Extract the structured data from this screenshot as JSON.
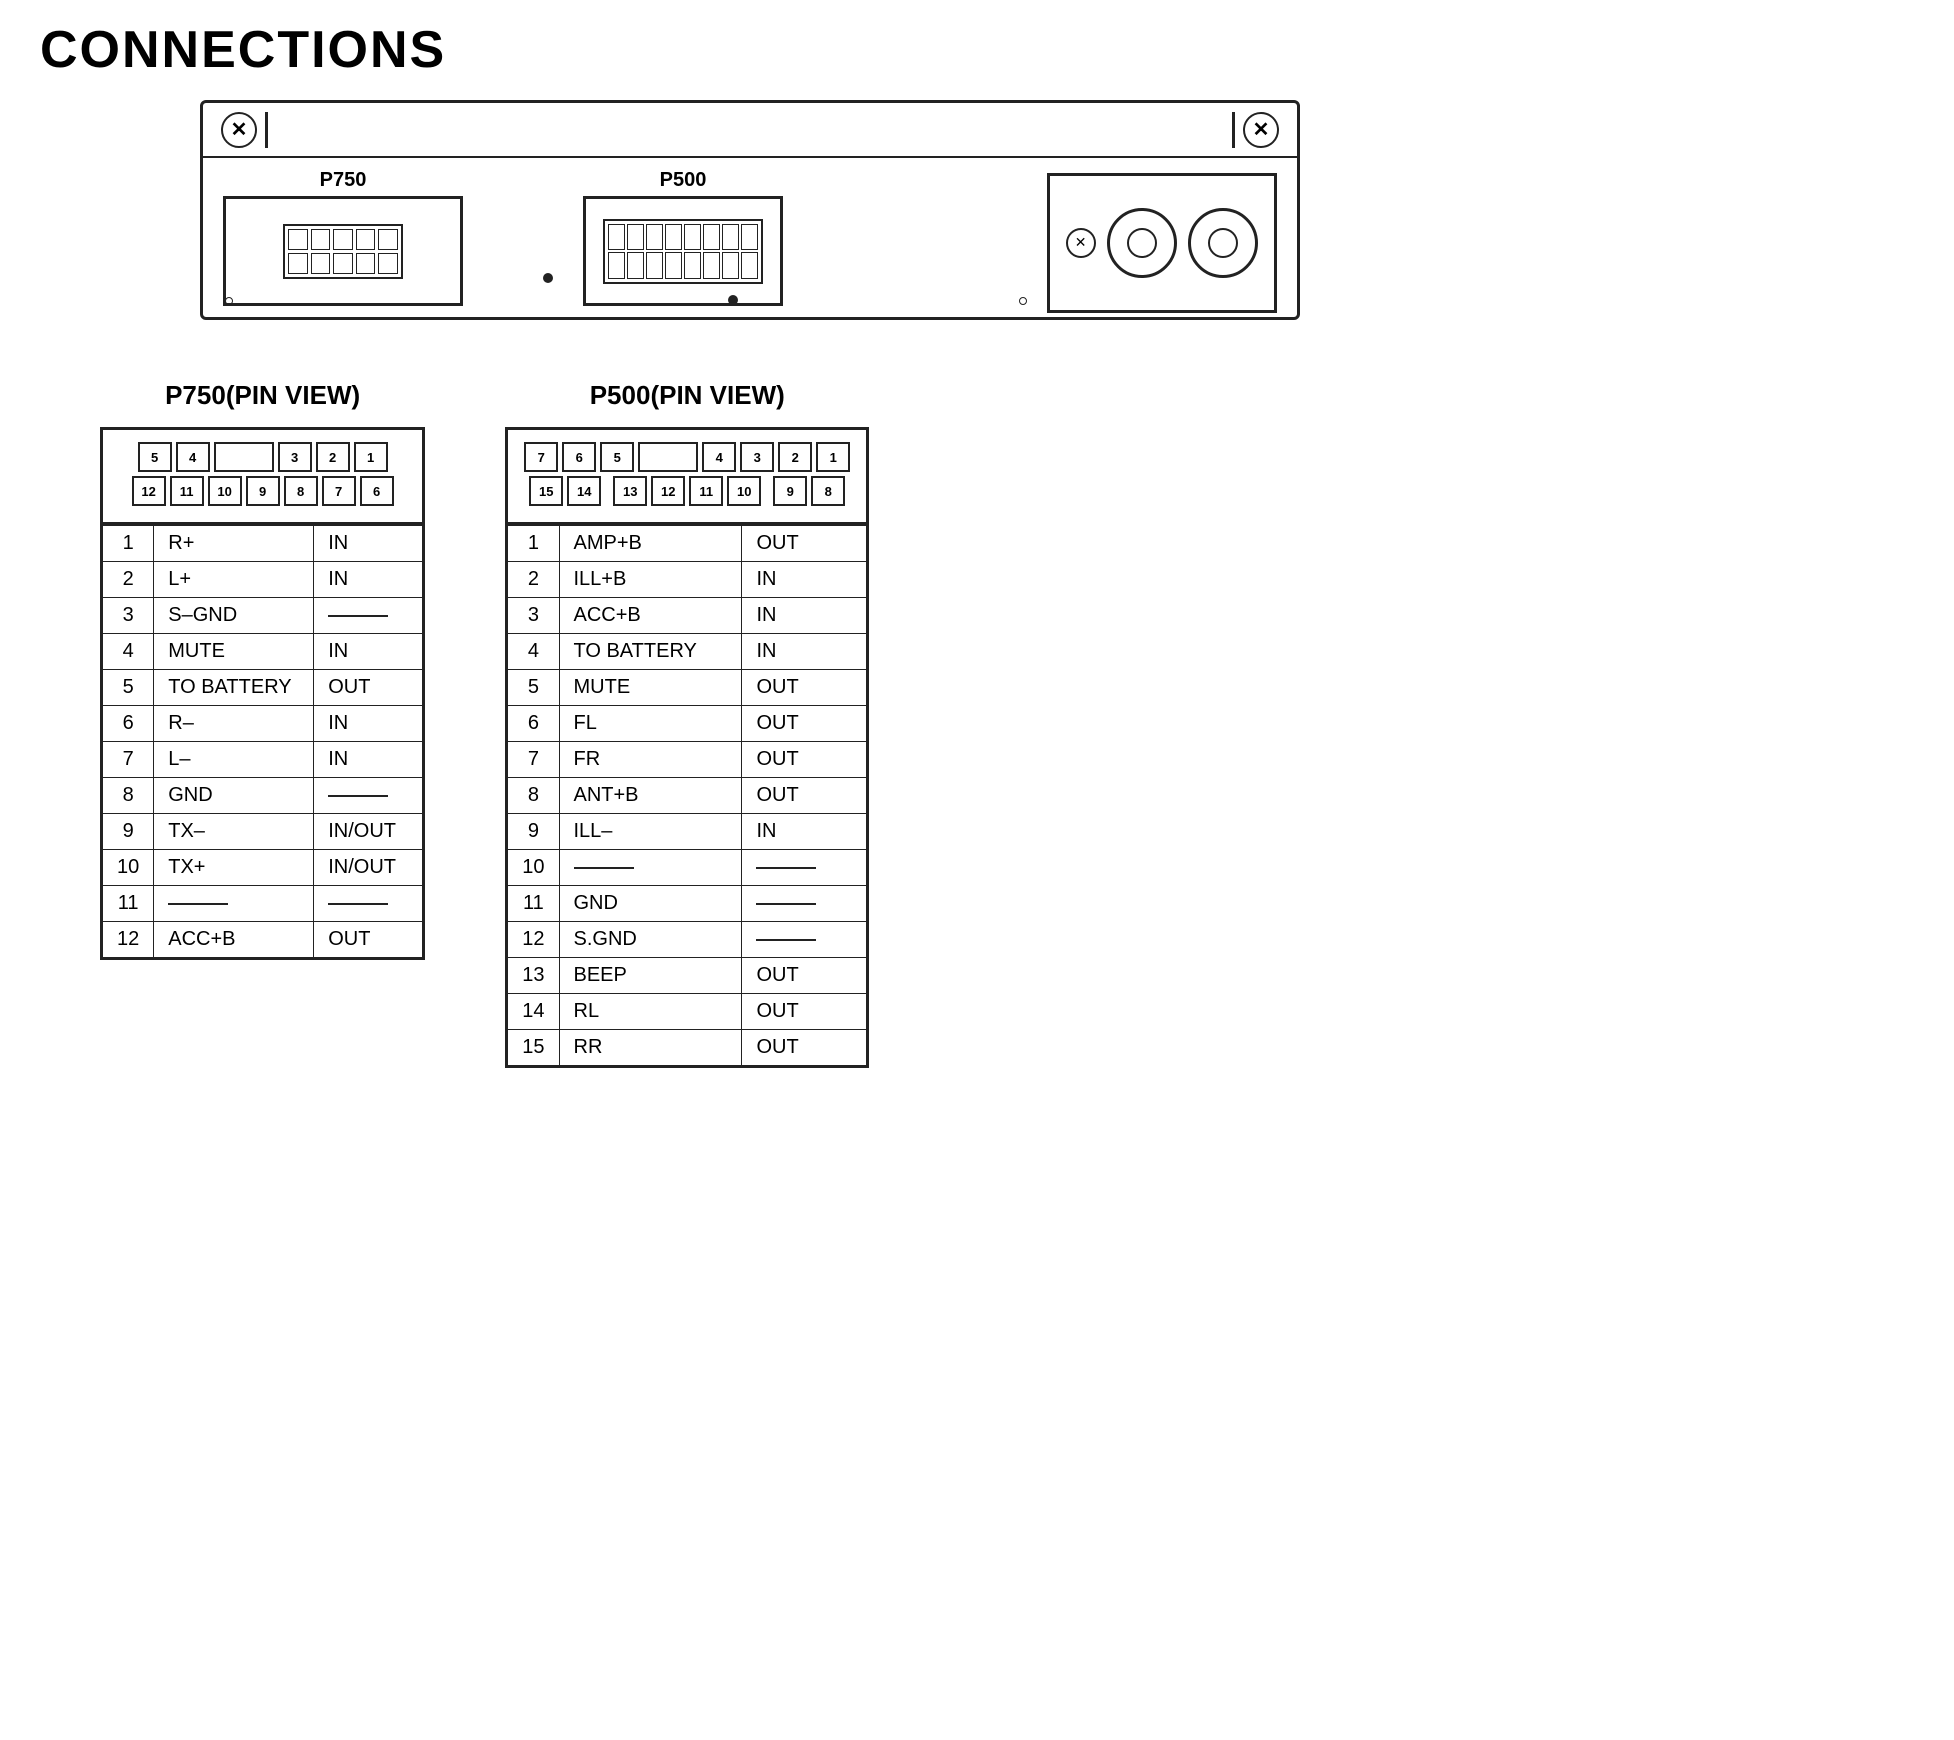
{
  "title": "CONNECTIONS",
  "unit": {
    "p750_label": "P750",
    "p500_label": "P500"
  },
  "p750_pin_view": {
    "title": "P750(PIN VIEW)",
    "top_row": [
      "5",
      "4",
      "",
      "3",
      "2",
      "1"
    ],
    "bottom_row": [
      "12",
      "11",
      "10",
      "9",
      "8",
      "7",
      "6"
    ],
    "pins": [
      {
        "num": "1",
        "signal": "R+",
        "dir": "IN"
      },
      {
        "num": "2",
        "signal": "L+",
        "dir": "IN"
      },
      {
        "num": "3",
        "signal": "S–GND",
        "dir": "—"
      },
      {
        "num": "4",
        "signal": "MUTE",
        "dir": "IN"
      },
      {
        "num": "5",
        "signal": "TO BATTERY",
        "dir": "OUT"
      },
      {
        "num": "6",
        "signal": "R–",
        "dir": "IN"
      },
      {
        "num": "7",
        "signal": "L–",
        "dir": "IN"
      },
      {
        "num": "8",
        "signal": "GND",
        "dir": "—"
      },
      {
        "num": "9",
        "signal": "TX–",
        "dir": "IN/OUT"
      },
      {
        "num": "10",
        "signal": "TX+",
        "dir": "IN/OUT"
      },
      {
        "num": "11",
        "signal": "—",
        "dir": "—"
      },
      {
        "num": "12",
        "signal": "ACC+B",
        "dir": "OUT"
      }
    ]
  },
  "p500_pin_view": {
    "title": "P500(PIN VIEW)",
    "top_row": [
      "7",
      "6",
      "5",
      "",
      "4",
      "3",
      "2",
      "1"
    ],
    "bottom_row": [
      "15",
      "14",
      "",
      "13",
      "12",
      "11",
      "10",
      "",
      "9",
      "8"
    ],
    "pins": [
      {
        "num": "1",
        "signal": "AMP+B",
        "dir": "OUT"
      },
      {
        "num": "2",
        "signal": "ILL+B",
        "dir": "IN"
      },
      {
        "num": "3",
        "signal": "ACC+B",
        "dir": "IN"
      },
      {
        "num": "4",
        "signal": "TO BATTERY",
        "dir": "IN"
      },
      {
        "num": "5",
        "signal": "MUTE",
        "dir": "OUT"
      },
      {
        "num": "6",
        "signal": "FL",
        "dir": "OUT"
      },
      {
        "num": "7",
        "signal": "FR",
        "dir": "OUT"
      },
      {
        "num": "8",
        "signal": "ANT+B",
        "dir": "OUT"
      },
      {
        "num": "9",
        "signal": "ILL–",
        "dir": "IN"
      },
      {
        "num": "10",
        "signal": "—",
        "dir": "—"
      },
      {
        "num": "11",
        "signal": "GND",
        "dir": "—"
      },
      {
        "num": "12",
        "signal": "S.GND",
        "dir": "—"
      },
      {
        "num": "13",
        "signal": "BEEP",
        "dir": "OUT"
      },
      {
        "num": "14",
        "signal": "RL",
        "dir": "OUT"
      },
      {
        "num": "15",
        "signal": "RR",
        "dir": "OUT"
      }
    ]
  }
}
